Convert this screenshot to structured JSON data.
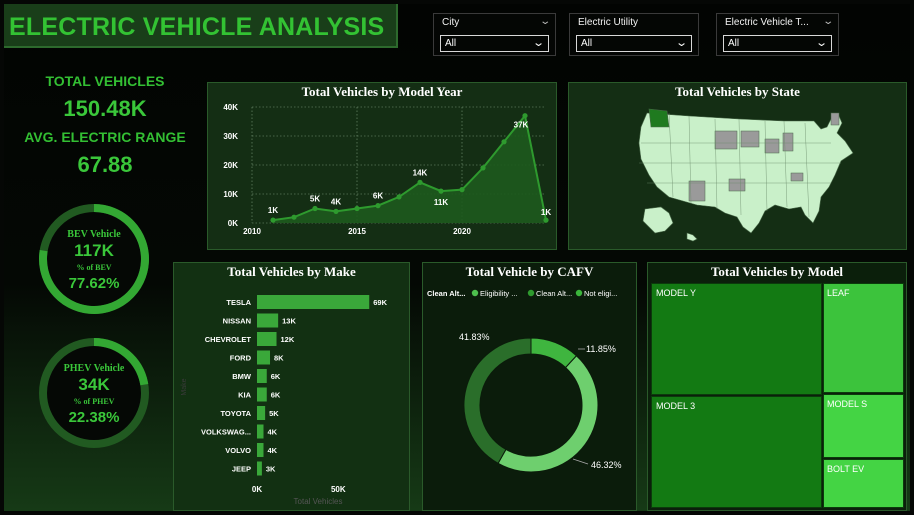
{
  "header": {
    "title": "ELECTRIC VEHICLE ANALYSIS"
  },
  "slicers": [
    {
      "label": "City",
      "value": "All"
    },
    {
      "label": "Electric Utility",
      "value": "All"
    },
    {
      "label": "Electric Vehicle T...",
      "value": "All"
    }
  ],
  "kpis": {
    "total_label": "TOTAL VEHICLES",
    "total_value": "150.48K",
    "range_label": "AVG. ELECTRIC RANGE",
    "range_value": "67.88"
  },
  "bev": {
    "title": "BEV Vehicle",
    "count": "117K",
    "pct_label": "% of BEV",
    "pct": "77.62%",
    "fraction": 0.7762
  },
  "phev": {
    "title": "PHEV Vehicle",
    "count": "34K",
    "pct_label": "% of PHEV",
    "pct": "22.38%",
    "fraction": 0.2238
  },
  "colors": {
    "accent": "#33c233",
    "panel": "#142e14",
    "bar": "#3aa83a",
    "line": "#2e9a2e"
  },
  "chart_data": [
    {
      "type": "area",
      "title": "Total Vehicles by Model Year",
      "x": [
        2011,
        2012,
        2013,
        2014,
        2015,
        2016,
        2017,
        2018,
        2019,
        2020,
        2021,
        2022,
        2023,
        2024
      ],
      "values": [
        1000,
        2000,
        5000,
        4000,
        5000,
        6000,
        9000,
        14000,
        11000,
        11500,
        19000,
        28000,
        37000,
        1000
      ],
      "point_labels": {
        "2011": "1K",
        "2013": "5K",
        "2014": "4K",
        "2016": "6K",
        "2018": "14K",
        "2019": "11K",
        "2023": "37K",
        "2024": "1K"
      },
      "y_ticks": [
        "0K",
        "10K",
        "20K",
        "30K",
        "40K"
      ],
      "x_ticks": [
        "2010",
        "2015",
        "2020"
      ],
      "xlim": [
        2010,
        2024
      ],
      "ylim": [
        0,
        40000
      ]
    },
    {
      "type": "bar",
      "orientation": "horizontal",
      "title": "Total Vehicles by Make",
      "categories": [
        "TESLA",
        "NISSAN",
        "CHEVROLET",
        "FORD",
        "BMW",
        "KIA",
        "TOYOTA",
        "VOLKSWAG...",
        "VOLVO",
        "JEEP"
      ],
      "values": [
        69000,
        13000,
        12000,
        8000,
        6000,
        6000,
        5000,
        4000,
        4000,
        3000
      ],
      "labels": [
        "69K",
        "13K",
        "12K",
        "8K",
        "6K",
        "6K",
        "5K",
        "4K",
        "4K",
        "3K"
      ],
      "x_ticks": [
        "0K",
        "50K"
      ],
      "xlabel": "Total Vehicles",
      "ylabel": "Make",
      "xlim": [
        0,
        75000
      ]
    },
    {
      "type": "pie",
      "subtype": "donut",
      "title": "Total Vehicle by CAFV",
      "legend_title": "Clean Alt...",
      "legend_items": [
        "Eligibility ...",
        "Clean Alt...",
        "Not eligi..."
      ],
      "legend_colors": [
        "#4dbf4d",
        "#2e9a2e",
        "#3bb53b"
      ],
      "legend_position": "top",
      "slice_labels": [
        "46.32%",
        "41.83%",
        "11.85%"
      ],
      "values": [
        46.32,
        41.83,
        11.85
      ],
      "slice_colors": [
        "#6ecf6e",
        "#2a6e2a",
        "#3fb53f"
      ]
    },
    {
      "type": "table",
      "subtype": "treemap",
      "title": "Total Vehicles by Model",
      "categories": [
        "MODEL Y",
        "MODEL 3",
        "LEAF",
        "MODEL S",
        "BOLT EV"
      ],
      "tile_colors": [
        "#137a13",
        "#137a13",
        "#3cc33c",
        "#44d444",
        "#44d444"
      ]
    },
    {
      "type": "map",
      "title": "Total Vehicles by State"
    }
  ]
}
